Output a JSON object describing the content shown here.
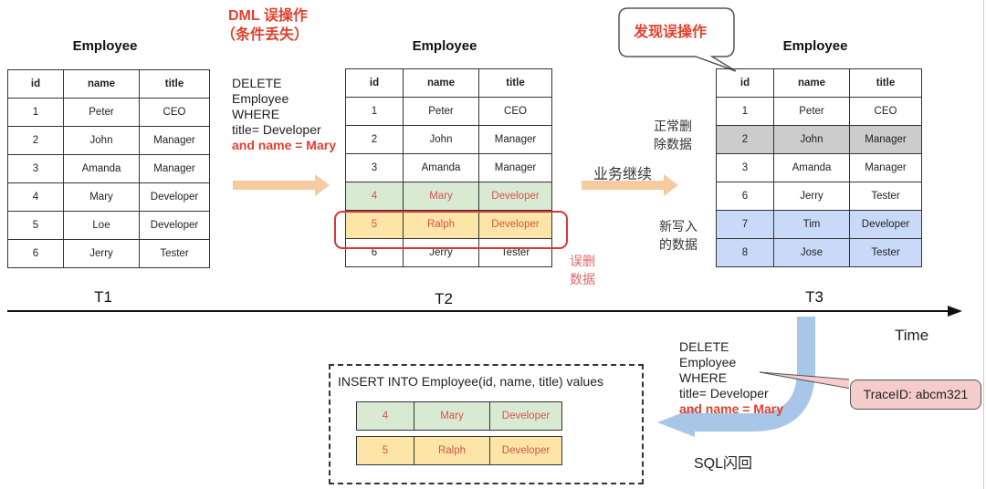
{
  "diagram": {
    "dml_error_title": "DML 误操作",
    "dml_error_subtitle": "（条件丢失）",
    "discovered_bubble": "发现误操作",
    "business_continue": "业务继续",
    "normal_delete_label": [
      "正常删",
      "除数据"
    ],
    "new_write_label": [
      "新写入",
      "的数据"
    ],
    "mis_delete_label": [
      "误删",
      "数据"
    ],
    "time_label": "Time",
    "flashback_label": "SQL闪回",
    "trace_id": "TraceID: abcm321",
    "colors": {
      "accent_red": "#e0412f",
      "arrow_orange": "#f4cca0",
      "arrow_blue": "#a8c6e8",
      "green_row": "#d9ead3",
      "yellow_row": "#fce5a6",
      "grey_row": "#cccccc",
      "blue_row": "#c9daf8"
    }
  },
  "sql_delete_top": {
    "lines": [
      "DELETE",
      "Employee",
      "WHERE",
      "title= Developer"
    ],
    "highlight": "and name = Mary"
  },
  "sql_delete_bottom": {
    "lines": [
      "DELETE",
      "Employee",
      "WHERE",
      "title= Developer"
    ],
    "highlight": "and name = Mary"
  },
  "insert": {
    "statement": "INSERT INTO Employee(id, name, title) values",
    "rows": [
      {
        "id": "4",
        "name": "Mary",
        "title": "Developer"
      },
      {
        "id": "5",
        "name": "Ralph",
        "title": "Developer"
      }
    ]
  },
  "tables": [
    {
      "title": "Employee",
      "time": "T1",
      "columns": [
        "id",
        "name",
        "title"
      ],
      "rows": [
        {
          "id": "1",
          "name": "Peter",
          "title": "CEO"
        },
        {
          "id": "2",
          "name": "John",
          "title": "Manager"
        },
        {
          "id": "3",
          "name": "Amanda",
          "title": "Manager"
        },
        {
          "id": "4",
          "name": "Mary",
          "title": "Developer"
        },
        {
          "id": "5",
          "name": "Loe",
          "title": "Developer"
        },
        {
          "id": "6",
          "name": "Jerry",
          "title": "Tester"
        }
      ]
    },
    {
      "title": "Employee",
      "time": "T2",
      "columns": [
        "id",
        "name",
        "title"
      ],
      "rows": [
        {
          "id": "1",
          "name": "Peter",
          "title": "CEO"
        },
        {
          "id": "2",
          "name": "John",
          "title": "Manager"
        },
        {
          "id": "3",
          "name": "Amanda",
          "title": "Manager"
        },
        {
          "id": "4",
          "name": "Mary",
          "title": "Developer"
        },
        {
          "id": "5",
          "name": "Ralph",
          "title": "Developer"
        },
        {
          "id": "6",
          "name": "Jerry",
          "title": "Tester"
        }
      ]
    },
    {
      "title": "Employee",
      "time": "T3",
      "columns": [
        "id",
        "name",
        "title"
      ],
      "rows": [
        {
          "id": "1",
          "name": "Peter",
          "title": "CEO"
        },
        {
          "id": "2",
          "name": "John",
          "title": "Manager"
        },
        {
          "id": "3",
          "name": "Amanda",
          "title": "Manager"
        },
        {
          "id": "6",
          "name": "Jerry",
          "title": "Tester"
        },
        {
          "id": "7",
          "name": "Tim",
          "title": "Developer"
        },
        {
          "id": "8",
          "name": "Jose",
          "title": "Tester"
        }
      ]
    }
  ]
}
